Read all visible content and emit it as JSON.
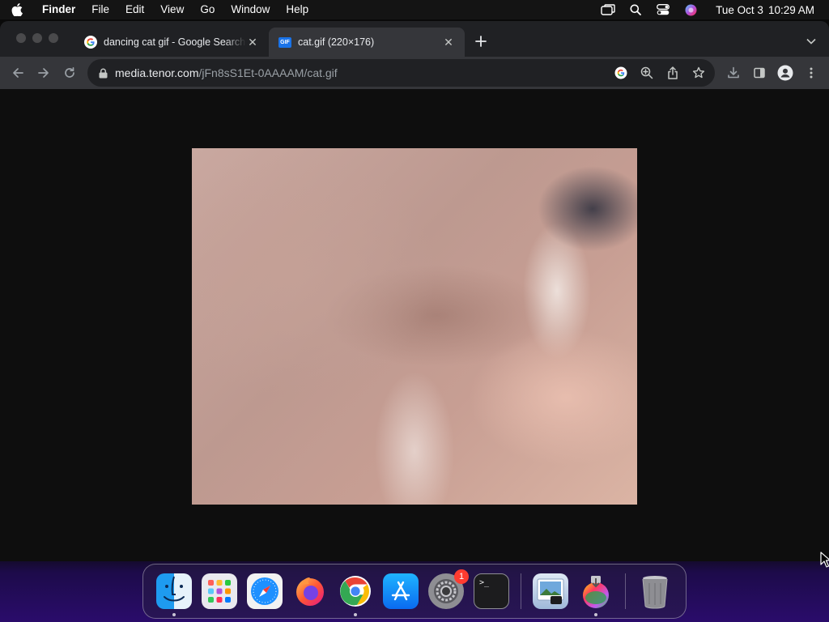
{
  "menubar": {
    "app_name": "Finder",
    "menus": [
      "File",
      "Edit",
      "View",
      "Go",
      "Window",
      "Help"
    ],
    "date": "Tue Oct 3",
    "time": "10:29 AM",
    "icons": [
      "apple-icon",
      "screen-mirroring-icon",
      "spotlight-search-icon",
      "control-center-icon",
      "siri-icon"
    ]
  },
  "browser": {
    "tabs": [
      {
        "title": "dancing cat gif - Google Search",
        "favicon": "google-icon",
        "active": false
      },
      {
        "title": "cat.gif (220×176)",
        "favicon": "gif-icon",
        "favicon_text": "GIF",
        "active": true
      }
    ],
    "address": {
      "host": "media.tenor.com",
      "path": "/jFn8sS1Et-0AAAAM/cat.gif"
    },
    "toolbar_icons": [
      "back-icon",
      "forward-icon",
      "reload-icon",
      "google-lens-icon",
      "zoom-icon",
      "share-icon",
      "bookmark-star-icon",
      "download-icon",
      "side-panel-icon",
      "profile-icon",
      "menu-kebab-icon"
    ]
  },
  "dock": {
    "apps": [
      {
        "name": "Finder",
        "running": true
      },
      {
        "name": "Launchpad",
        "running": false
      },
      {
        "name": "Safari",
        "running": false
      },
      {
        "name": "Firefox",
        "running": false
      },
      {
        "name": "Chrome",
        "running": true
      },
      {
        "name": "App Store",
        "running": false
      },
      {
        "name": "System Settings",
        "running": false,
        "badge": "1"
      },
      {
        "name": "Terminal",
        "running": false,
        "label": ">_"
      },
      {
        "name": "Preview",
        "running": false
      },
      {
        "name": "Installer",
        "running": true
      },
      {
        "name": "Trash",
        "running": false
      }
    ]
  },
  "colors": {
    "tab_strip": "#202124",
    "toolbar": "#35363a",
    "omnibox": "#202124",
    "content_bg": "#0e0e0e",
    "badge": "#ff3b30"
  }
}
